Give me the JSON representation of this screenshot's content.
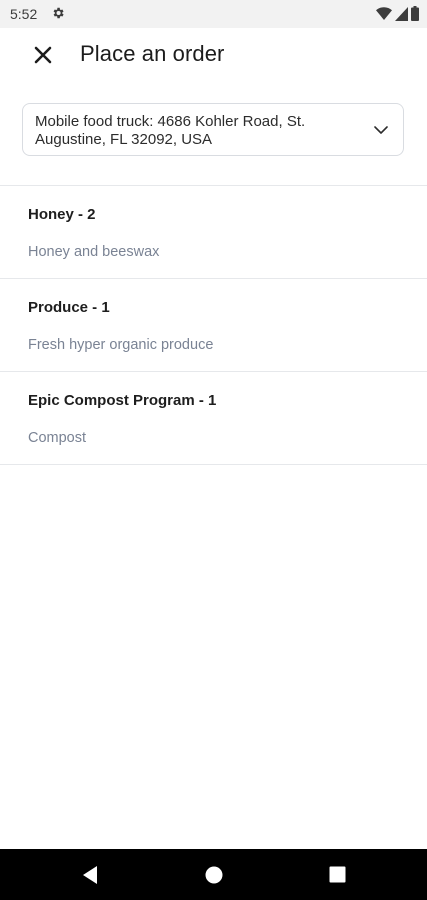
{
  "status_bar": {
    "time": "5:52",
    "icons": [
      "gear-icon",
      "wifi-icon",
      "signal-icon",
      "battery-icon"
    ]
  },
  "app_bar": {
    "close_icon": "close-icon",
    "title": "Place an order"
  },
  "location_select": {
    "value": "Mobile food truck: 4686 Kohler Road, St. Augustine, FL 32092, USA",
    "icon": "chevron-down-icon"
  },
  "items": [
    {
      "title": "Honey - 2",
      "description": "Honey and beeswax"
    },
    {
      "title": "Produce - 1",
      "description": "Fresh hyper organic produce"
    },
    {
      "title": "Epic Compost Program - 1",
      "description": "Compost"
    }
  ],
  "nav_bar": {
    "icons": [
      "back-icon",
      "home-icon",
      "recents-icon"
    ]
  },
  "colors": {
    "status_bar_bg": "#f2f2f2",
    "title_text": "#1c1c1c",
    "description_text": "#7a8394",
    "divider": "#e6e8eb",
    "nav_bar_bg": "#000000"
  }
}
